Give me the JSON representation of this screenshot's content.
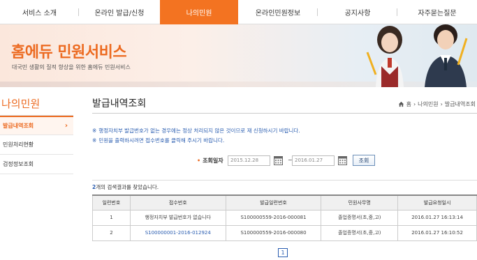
{
  "nav": {
    "items": [
      {
        "label": "서비스 소개",
        "active": false
      },
      {
        "label": "온라인 발급/신청",
        "active": false
      },
      {
        "label": "나의민원",
        "active": true
      },
      {
        "label": "온라인민원정보",
        "active": false
      },
      {
        "label": "공지사항",
        "active": false
      },
      {
        "label": "자주묻는질문",
        "active": false
      }
    ]
  },
  "banner": {
    "title": "홈에듀 민원서비스",
    "subtitle": "대국민 생활의 질적 향상을 위한 홈에듀 민원서비스"
  },
  "sidebar": {
    "title": "나의민원",
    "items": [
      {
        "label": "발급내역조회",
        "active": true
      },
      {
        "label": "민원처리현황",
        "active": false
      },
      {
        "label": "검정정보조회",
        "active": false
      }
    ]
  },
  "page": {
    "title": "발급내역조회",
    "breadcrumb": [
      "홈",
      "나의민원",
      "발급내역조회"
    ]
  },
  "notices": [
    "행정자치부 발급번호가 없는 경우에는 정상 처리되지 않은 것이므로 재 신청하시기 바랍니다.",
    "민원을 출력하시려면 접수번호를 클릭해 주시기 바랍니다."
  ],
  "search": {
    "label": "조회일자",
    "from_date": "2015.12.28",
    "to_date": "2016.01.27",
    "tilde": "~",
    "button_label": "조회"
  },
  "result": {
    "count": "2",
    "suffix": "개의 검색결과를 찾았습니다."
  },
  "table": {
    "headers": [
      "일련번호",
      "접수번호",
      "발급일련번호",
      "민원사무명",
      "발급요청일시"
    ],
    "rows": [
      [
        "1",
        "행정자치부 발급번호가 없습니다",
        "S100000559-2016-000081",
        "졸업증명서(초,중,고)",
        "2016.01.27 16:13:14"
      ],
      [
        "2",
        "S100000001-2016-012924",
        "S100000559-2016-000080",
        "졸업증명서(초,중,고)",
        "2016.01.27 16:10:52"
      ]
    ]
  },
  "pagination": {
    "current": "1"
  },
  "colors": {
    "accent": "#f37321",
    "link": "#2a5db0"
  }
}
